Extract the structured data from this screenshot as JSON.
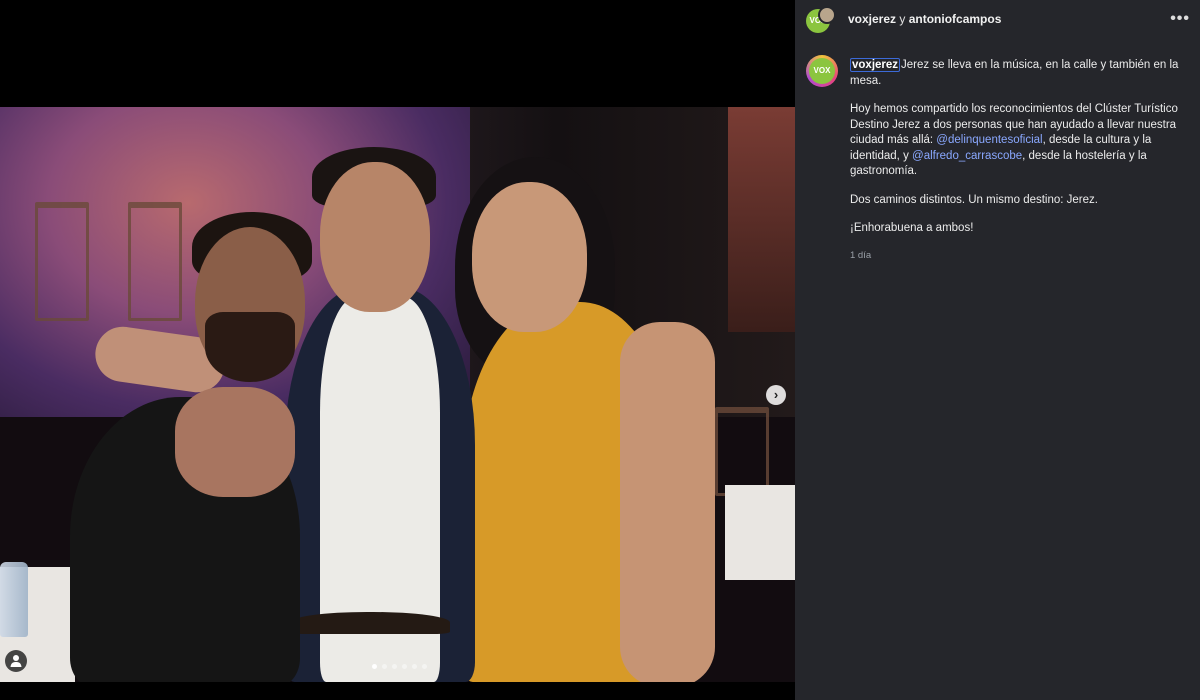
{
  "post": {
    "header": {
      "user_primary": "voxjerez",
      "conjunction": "y",
      "user_secondary": "antoniofcampos",
      "avatar_text": "VOX",
      "more_icon": "•••"
    },
    "caption": {
      "username": "voxjerez",
      "line1": "Jerez se lleva en la música, en la calle y también en la mesa.",
      "p2_part1": "Hoy hemos compartido los reconocimientos del Clúster Turístico Destino Jerez a dos personas que han ayudado a llevar nuestra ciudad más allá: ",
      "mention1": "@delinquentesoficial",
      "p2_part2": ", desde la cultura y la identidad, y ",
      "mention2": "@alfredo_carrascobe",
      "p2_part3": ", desde la hostelería y la gastronomía.",
      "p3": "Dos caminos distintos. Un mismo destino: Jerez.",
      "p4": "¡Enhorabuena a ambos!",
      "time": "1 día"
    },
    "media": {
      "next_icon": "›",
      "carousel_count": 6,
      "carousel_active": 1
    }
  },
  "colors": {
    "panel_bg": "#25262b",
    "mention": "#8aa8ff",
    "vox_green": "#8bc53f"
  }
}
